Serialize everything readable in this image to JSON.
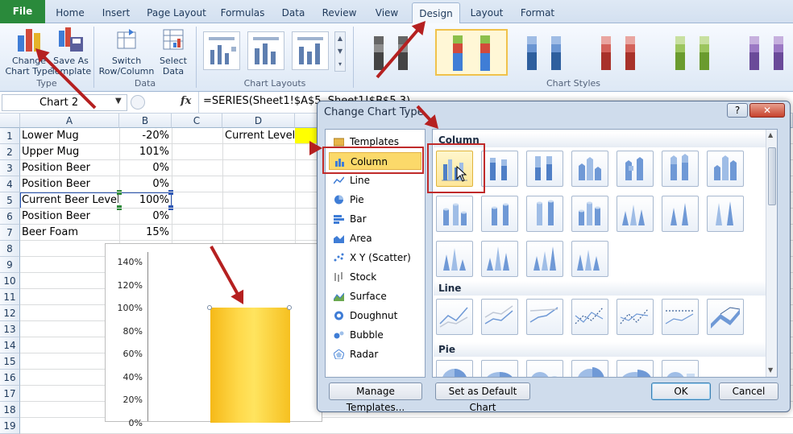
{
  "tabs": [
    "File",
    "Home",
    "Insert",
    "Page Layout",
    "Formulas",
    "Data",
    "Review",
    "View",
    "Design",
    "Layout",
    "Format"
  ],
  "ribbon": {
    "change_chart_type": "Change\nChart Type",
    "save_as_template": "Save As\nTemplate",
    "type_group": "Type",
    "switch_row_column": "Switch\nRow/Column",
    "select_data": "Select\nData",
    "data_group": "Data",
    "chart_layouts_group": "Chart Layouts",
    "chart_styles_group": "Chart Styles"
  },
  "formula_bar": {
    "name_box": "Chart 2",
    "fx": "fx",
    "formula": "=SERIES(Sheet1!$A$5,,Sheet1!$B$5,3)"
  },
  "sheet": {
    "columns": [
      "A",
      "B",
      "C",
      "D"
    ],
    "rows": [
      "1",
      "2",
      "3",
      "4",
      "5",
      "6",
      "7",
      "8",
      "9",
      "10",
      "11",
      "12",
      "13",
      "14",
      "15",
      "16",
      "17",
      "18",
      "19"
    ],
    "labels": [
      "Lower Mug",
      "Upper Mug",
      "Position Beer",
      "Position Beer",
      "Current Beer Level",
      "Position Beer",
      "Beer Foam"
    ],
    "values": [
      "-20%",
      "101%",
      "0%",
      "0%",
      "100%",
      "0%",
      "15%"
    ],
    "d1": "Current Level"
  },
  "chart": {
    "y_ticks": [
      "140%",
      "120%",
      "100%",
      "80%",
      "60%",
      "40%",
      "20%",
      "0%"
    ],
    "bar_value": 1.0,
    "ylim": [
      0,
      1.4
    ],
    "bar_color": "#f9c81e"
  },
  "dialog": {
    "title": "Change Chart Type",
    "help": "?",
    "close": "✕",
    "categories": [
      "Templates",
      "Column",
      "Line",
      "Pie",
      "Bar",
      "Area",
      "X Y (Scatter)",
      "Stock",
      "Surface",
      "Doughnut",
      "Bubble",
      "Radar"
    ],
    "selected_category": "Column",
    "section_column": "Column",
    "section_line": "Line",
    "section_pie": "Pie",
    "manage_templates": "Manage Templates...",
    "set_default": "Set as Default Chart",
    "ok": "OK",
    "cancel": "Cancel"
  },
  "colors": {
    "file_tab": "#2a8a3b",
    "accent_red": "#b52020",
    "selection": "#fbd96a"
  }
}
